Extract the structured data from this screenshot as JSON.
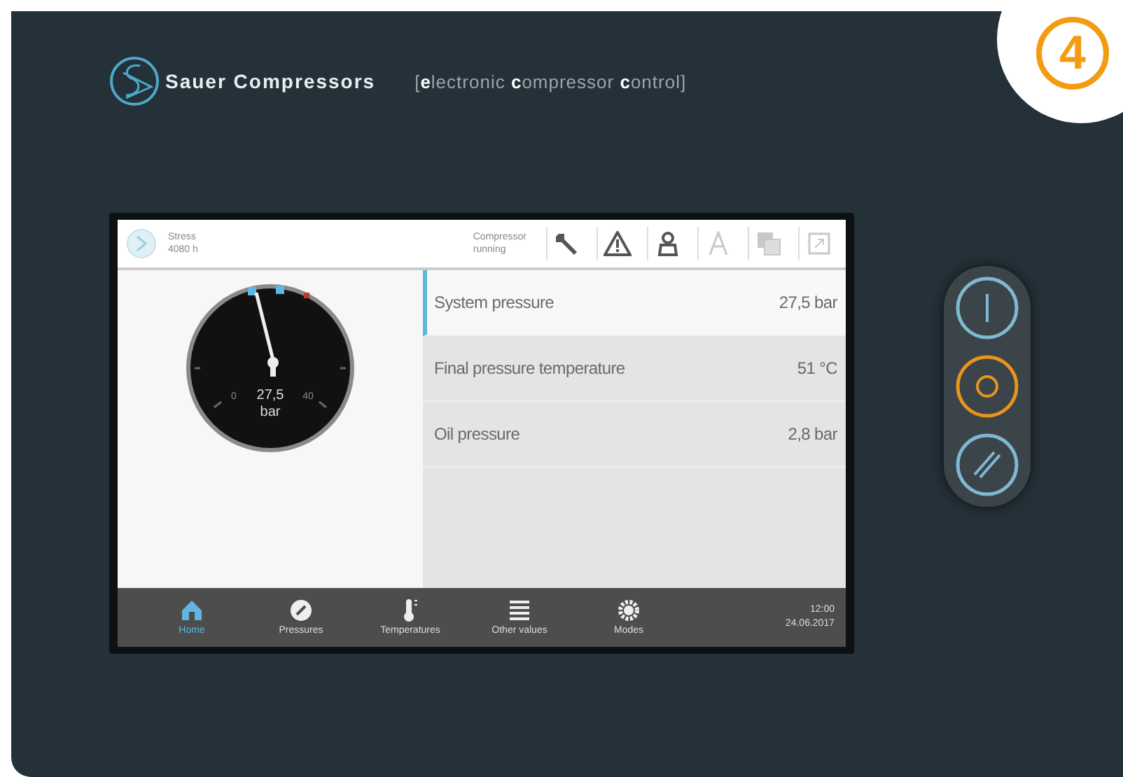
{
  "badge": "4",
  "brand": {
    "name": "Sauer Compressors",
    "tagline": "[**e**lectronic **c**ompressor **c**ontrol]"
  },
  "header": {
    "hours_label": "Stress",
    "hours_value": "4080 h",
    "status_line1": "Compressor",
    "status_line2": "running"
  },
  "toolbar": [
    {
      "kind": "wrench",
      "disabled": false
    },
    {
      "kind": "warning",
      "disabled": false
    },
    {
      "kind": "operator",
      "disabled": false
    },
    {
      "kind": "font",
      "disabled": true
    },
    {
      "kind": "copy",
      "disabled": true
    },
    {
      "kind": "export",
      "disabled": true
    }
  ],
  "gauge": {
    "value": "27,5",
    "unit": "bar",
    "min_label": "0",
    "max_label": "40"
  },
  "readings": [
    {
      "label": "System pressure",
      "value": "27,5 bar",
      "selected": true
    },
    {
      "label": "Final pressure temperature",
      "value": "51 °C",
      "selected": false
    },
    {
      "label": "Oil pressure",
      "value": "2,8 bar",
      "selected": false
    }
  ],
  "nav": [
    {
      "kind": "home",
      "label": "Home",
      "selected": true
    },
    {
      "kind": "gauge",
      "label": "Pressures",
      "selected": false
    },
    {
      "kind": "thermometer",
      "label": "Temperatures",
      "selected": false
    },
    {
      "kind": "list",
      "label": "Other values",
      "selected": false
    },
    {
      "kind": "gear",
      "label": "Modes",
      "selected": false
    }
  ],
  "clock": {
    "time": "12:00",
    "date": "24.06.2017"
  },
  "side_buttons": [
    {
      "kind": "on",
      "selected": false
    },
    {
      "kind": "off",
      "selected": true
    },
    {
      "kind": "reset",
      "selected": false
    }
  ]
}
